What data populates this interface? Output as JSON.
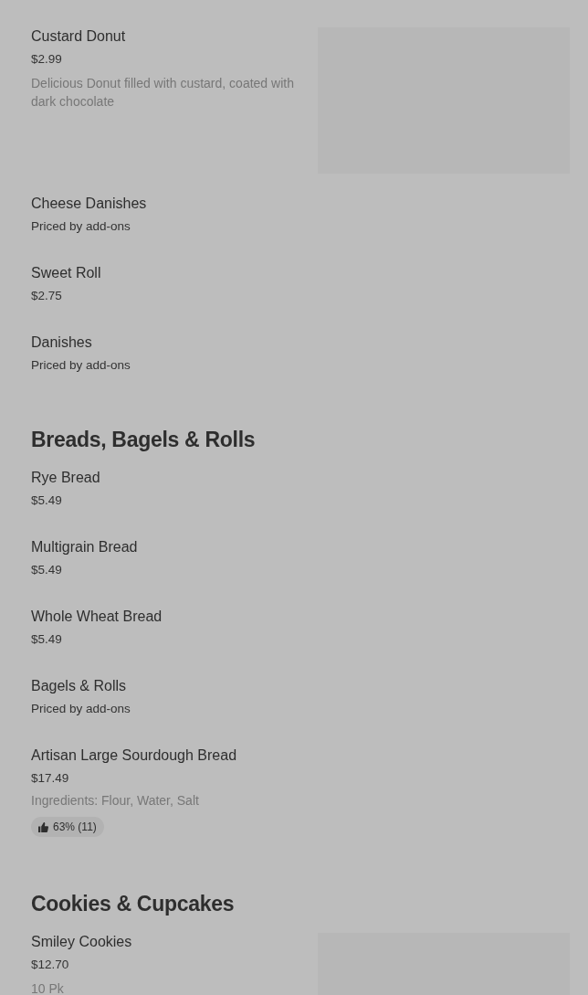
{
  "sections": [
    {
      "items": [
        {
          "kind": "with_picture",
          "name": "Custard Donut",
          "price": "$2.99",
          "description": "Delicious Donut filled with custard, coated with dark chocolate"
        },
        {
          "kind": "plain",
          "name": "Cheese Danishes",
          "price": "Priced by add-ons"
        },
        {
          "kind": "plain",
          "name": "Sweet Roll",
          "price": "$2.75"
        },
        {
          "kind": "plain",
          "name": "Danishes",
          "price": "Priced by add-ons"
        }
      ]
    },
    {
      "title": "Breads, Bagels & Rolls",
      "items": [
        {
          "kind": "plain",
          "name": "Rye Bread",
          "price": "$5.49"
        },
        {
          "kind": "plain",
          "name": "Multigrain Bread",
          "price": "$5.49"
        },
        {
          "kind": "plain",
          "name": "Whole Wheat Bread",
          "price": "$5.49"
        },
        {
          "kind": "plain",
          "name": "Bagels & Rolls",
          "price": "Priced by add-ons"
        },
        {
          "kind": "plain",
          "name": "Artisan Large Sourdough Bread",
          "price": "$17.49",
          "description": "Ingredients: Flour, Water, Salt",
          "rating": "63% (11)"
        }
      ]
    },
    {
      "title": "Cookies & Cupcakes",
      "items": [
        {
          "kind": "with_picture",
          "name": "Smiley Cookies",
          "price": "$12.70",
          "description": "10 Pk"
        }
      ]
    }
  ]
}
